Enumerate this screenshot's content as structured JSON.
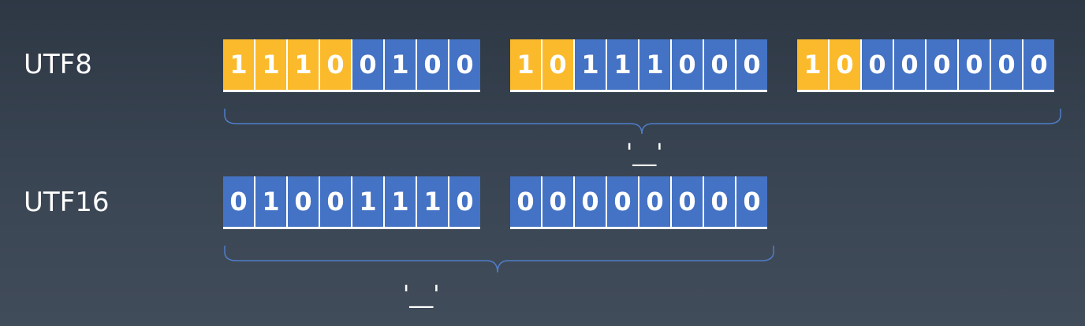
{
  "colors": {
    "header_bit": "#fbba2b",
    "payload_bit": "#4472c4",
    "brace": "#4f7ec9"
  },
  "rows": [
    {
      "label": "UTF8",
      "char": "'__'",
      "bytes": [
        {
          "bits": [
            "1",
            "1",
            "1",
            "0",
            "0",
            "1",
            "0",
            "0"
          ],
          "header_count": 4
        },
        {
          "bits": [
            "1",
            "0",
            "1",
            "1",
            "1",
            "0",
            "0",
            "0"
          ],
          "header_count": 2
        },
        {
          "bits": [
            "1",
            "0",
            "0",
            "0",
            "0",
            "0",
            "0",
            "0"
          ],
          "header_count": 2
        }
      ]
    },
    {
      "label": "UTF16",
      "char": "'__'",
      "bytes": [
        {
          "bits": [
            "0",
            "1",
            "0",
            "0",
            "1",
            "1",
            "1",
            "0"
          ],
          "header_count": 0
        },
        {
          "bits": [
            "0",
            "0",
            "0",
            "0",
            "0",
            "0",
            "0",
            "0"
          ],
          "header_count": 0
        }
      ]
    }
  ]
}
